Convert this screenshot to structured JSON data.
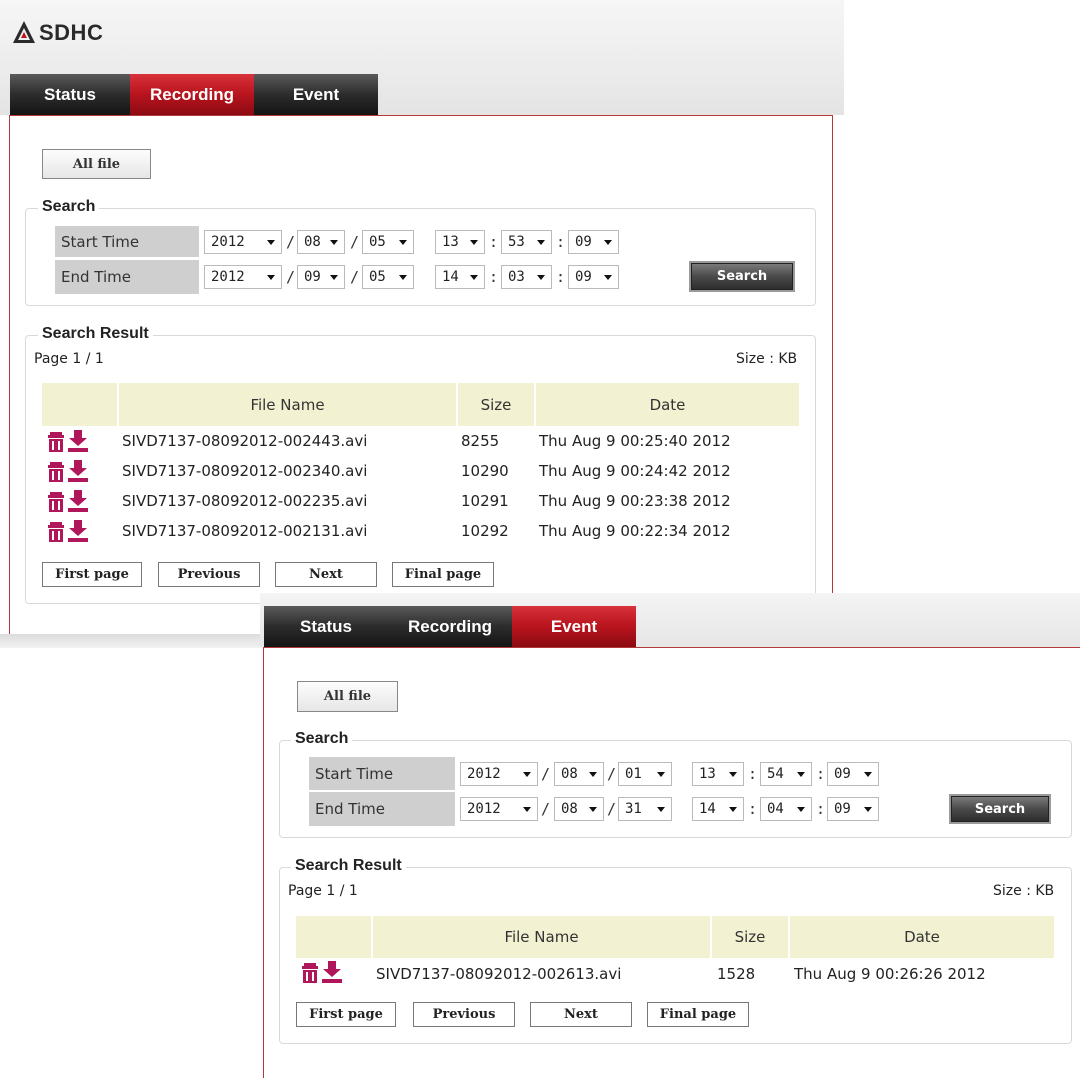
{
  "brand": {
    "name": "SDHC"
  },
  "colors": {
    "active_tab": "#b8141e",
    "frame_border": "#b23a3a",
    "header_fill": "#f2f2d2",
    "icon": "#b0165a"
  },
  "icons": {
    "delete": "trash-icon",
    "download": "download-icon",
    "logo": "logo-mark-icon",
    "dropdown": "chevron-down-icon"
  },
  "panel_recording": {
    "tabs": [
      {
        "label": "Status",
        "active": false
      },
      {
        "label": "Recording",
        "active": true
      },
      {
        "label": "Event",
        "active": false
      }
    ],
    "all_file_label": "All file",
    "search_legend": "Search",
    "start_label": "Start Time",
    "end_label": "End Time",
    "start": {
      "year": "2012",
      "month": "08",
      "day": "05",
      "hour": "13",
      "minute": "53",
      "second": "09"
    },
    "end": {
      "year": "2012",
      "month": "09",
      "day": "05",
      "hour": "14",
      "minute": "03",
      "second": "09"
    },
    "date_sep": "/",
    "time_sep": ":",
    "search_button": "Search",
    "result_legend": "Search Result",
    "page_info": "Page 1 / 1",
    "size_unit": "Size : KB",
    "columns": [
      "File Name",
      "Size",
      "Date"
    ],
    "rows": [
      {
        "file": "SIVD7137-08092012-002443.avi",
        "size": "8255",
        "date": "Thu Aug 9 00:25:40 2012"
      },
      {
        "file": "SIVD7137-08092012-002340.avi",
        "size": "10290",
        "date": "Thu Aug 9 00:24:42 2012"
      },
      {
        "file": "SIVD7137-08092012-002235.avi",
        "size": "10291",
        "date": "Thu Aug 9 00:23:38 2012"
      },
      {
        "file": "SIVD7137-08092012-002131.avi",
        "size": "10292",
        "date": "Thu Aug 9 00:22:34 2012"
      }
    ],
    "pager": [
      "First page",
      "Previous",
      "Next",
      "Final page"
    ]
  },
  "panel_event": {
    "tabs": [
      {
        "label": "Status",
        "active": false
      },
      {
        "label": "Recording",
        "active": false
      },
      {
        "label": "Event",
        "active": true
      }
    ],
    "all_file_label": "All file",
    "search_legend": "Search",
    "start_label": "Start Time",
    "end_label": "End Time",
    "start": {
      "year": "2012",
      "month": "08",
      "day": "01",
      "hour": "13",
      "minute": "54",
      "second": "09"
    },
    "end": {
      "year": "2012",
      "month": "08",
      "day": "31",
      "hour": "14",
      "minute": "04",
      "second": "09"
    },
    "date_sep": "/",
    "time_sep": ":",
    "search_button": "Search",
    "result_legend": "Search Result",
    "page_info": "Page 1 / 1",
    "size_unit": "Size : KB",
    "columns": [
      "File Name",
      "Size",
      "Date"
    ],
    "rows": [
      {
        "file": "SIVD7137-08092012-002613.avi",
        "size": "1528",
        "date": "Thu Aug 9 00:26:26 2012"
      }
    ],
    "pager": [
      "First page",
      "Previous",
      "Next",
      "Final page"
    ]
  }
}
